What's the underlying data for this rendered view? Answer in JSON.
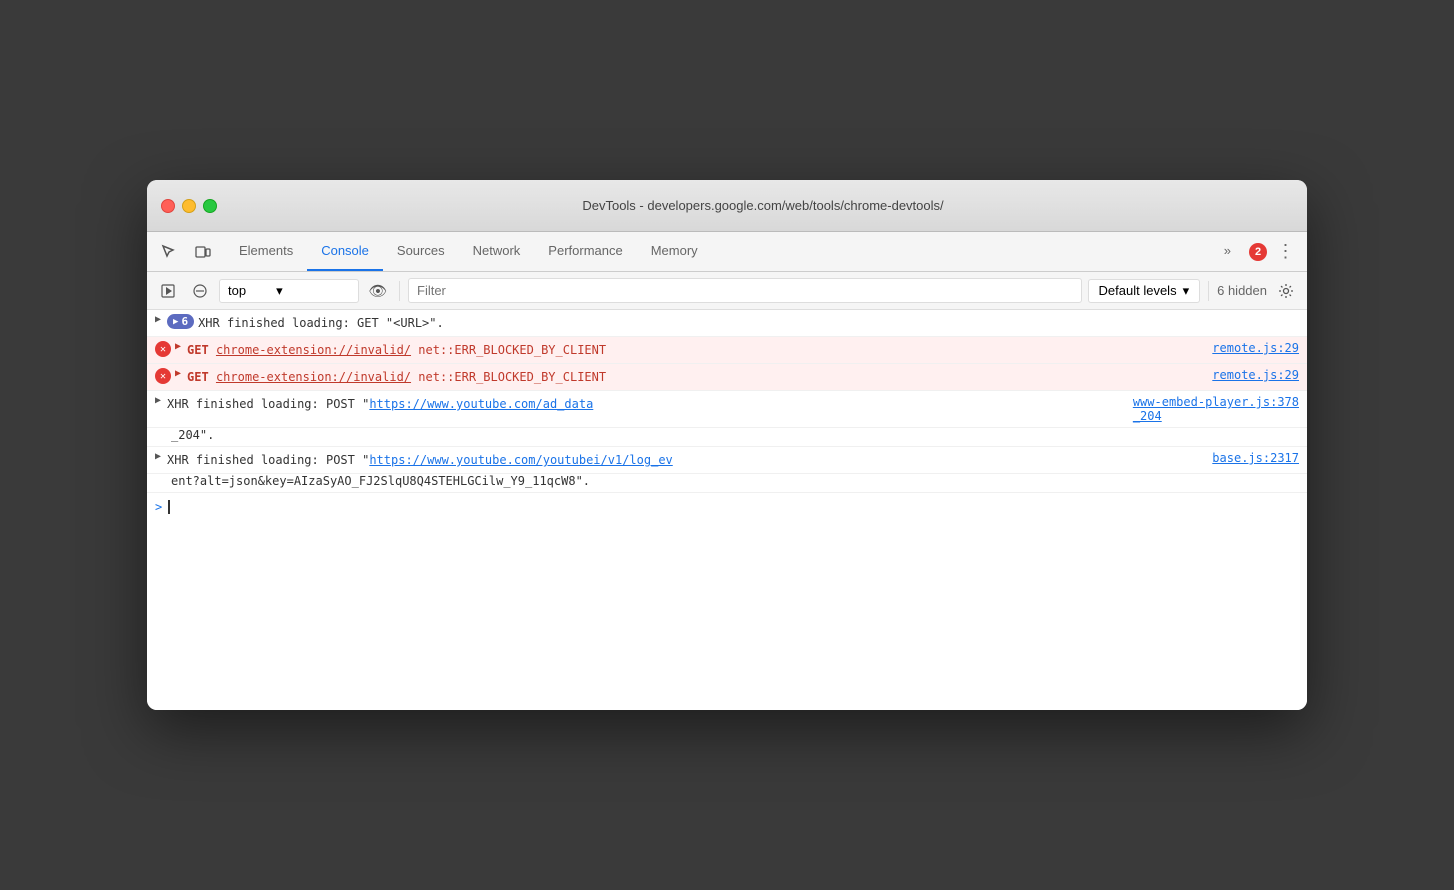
{
  "window": {
    "title": "DevTools - developers.google.com/web/tools/chrome-devtools/"
  },
  "tabs": {
    "items": [
      {
        "id": "elements",
        "label": "Elements",
        "active": false
      },
      {
        "id": "console",
        "label": "Console",
        "active": true
      },
      {
        "id": "sources",
        "label": "Sources",
        "active": false
      },
      {
        "id": "network",
        "label": "Network",
        "active": false
      },
      {
        "id": "performance",
        "label": "Performance",
        "active": false
      },
      {
        "id": "memory",
        "label": "Memory",
        "active": false
      }
    ],
    "more_label": "»",
    "error_count": "2"
  },
  "console_toolbar": {
    "context_label": "top",
    "filter_placeholder": "Filter",
    "levels_label": "Default levels",
    "hidden_label": "6 hidden"
  },
  "console_rows": [
    {
      "type": "xhr",
      "badge_count": "6",
      "text": "XHR finished loading: GET \"<URL>\".",
      "source": ""
    },
    {
      "type": "error",
      "method": "GET",
      "url": "chrome-extension://invalid/",
      "error": "net::ERR_BLOCKED_BY_CLIENT",
      "source": "remote.js:29"
    },
    {
      "type": "error",
      "method": "GET",
      "url": "chrome-extension://invalid/",
      "error": "net::ERR_BLOCKED_BY_CLIENT",
      "source": "remote.js:29"
    },
    {
      "type": "xhr_post",
      "text_pre": "XHR finished loading: POST \"",
      "url": "https://www.youtube.com/ad_data",
      "text_post": "\".",
      "source": "www-embed-player.js:378_204"
    },
    {
      "type": "xhr_post2",
      "text_pre": "XHR finished loading: POST \"",
      "url": "https://www.youtube.com/youtubei/v1/log_ev",
      "url2": "ent?alt=json&key=AIzaSyAO_FJ2SlqU8Q4STEHLGCilw_Y9_11qcW8",
      "text_post": "\".",
      "source": "base.js:2317"
    }
  ]
}
